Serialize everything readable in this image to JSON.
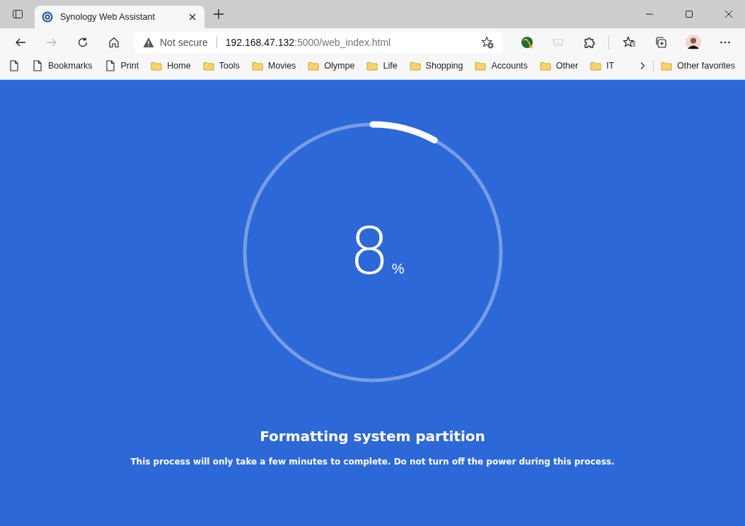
{
  "browser": {
    "tab": {
      "title": "Synology Web Assistant",
      "selected": true
    },
    "address": {
      "security": "Not secure",
      "host": "192.168.47.132",
      "path": ":5000/web_index.html"
    },
    "bookmarks": [
      {
        "kind": "page"
      },
      {
        "kind": "page",
        "label": "Bookmarks"
      },
      {
        "kind": "page",
        "label": "Print"
      },
      {
        "kind": "folder",
        "label": "Home"
      },
      {
        "kind": "folder",
        "label": "Tools"
      },
      {
        "kind": "folder",
        "label": "Movies"
      },
      {
        "kind": "folder",
        "label": "Olympe"
      },
      {
        "kind": "folder",
        "label": "Life"
      },
      {
        "kind": "folder",
        "label": "Shopping"
      },
      {
        "kind": "folder",
        "label": "Accounts"
      },
      {
        "kind": "folder",
        "label": "Other"
      },
      {
        "kind": "folder",
        "label": "IT"
      }
    ],
    "other_favorites": "Other favorites"
  },
  "progress": {
    "level": 0.08,
    "value": "8",
    "unit": "%"
  },
  "heading": "Formatting system partition",
  "message": "This process will only take a few minutes to complete. Do not turn off the power during this process."
}
